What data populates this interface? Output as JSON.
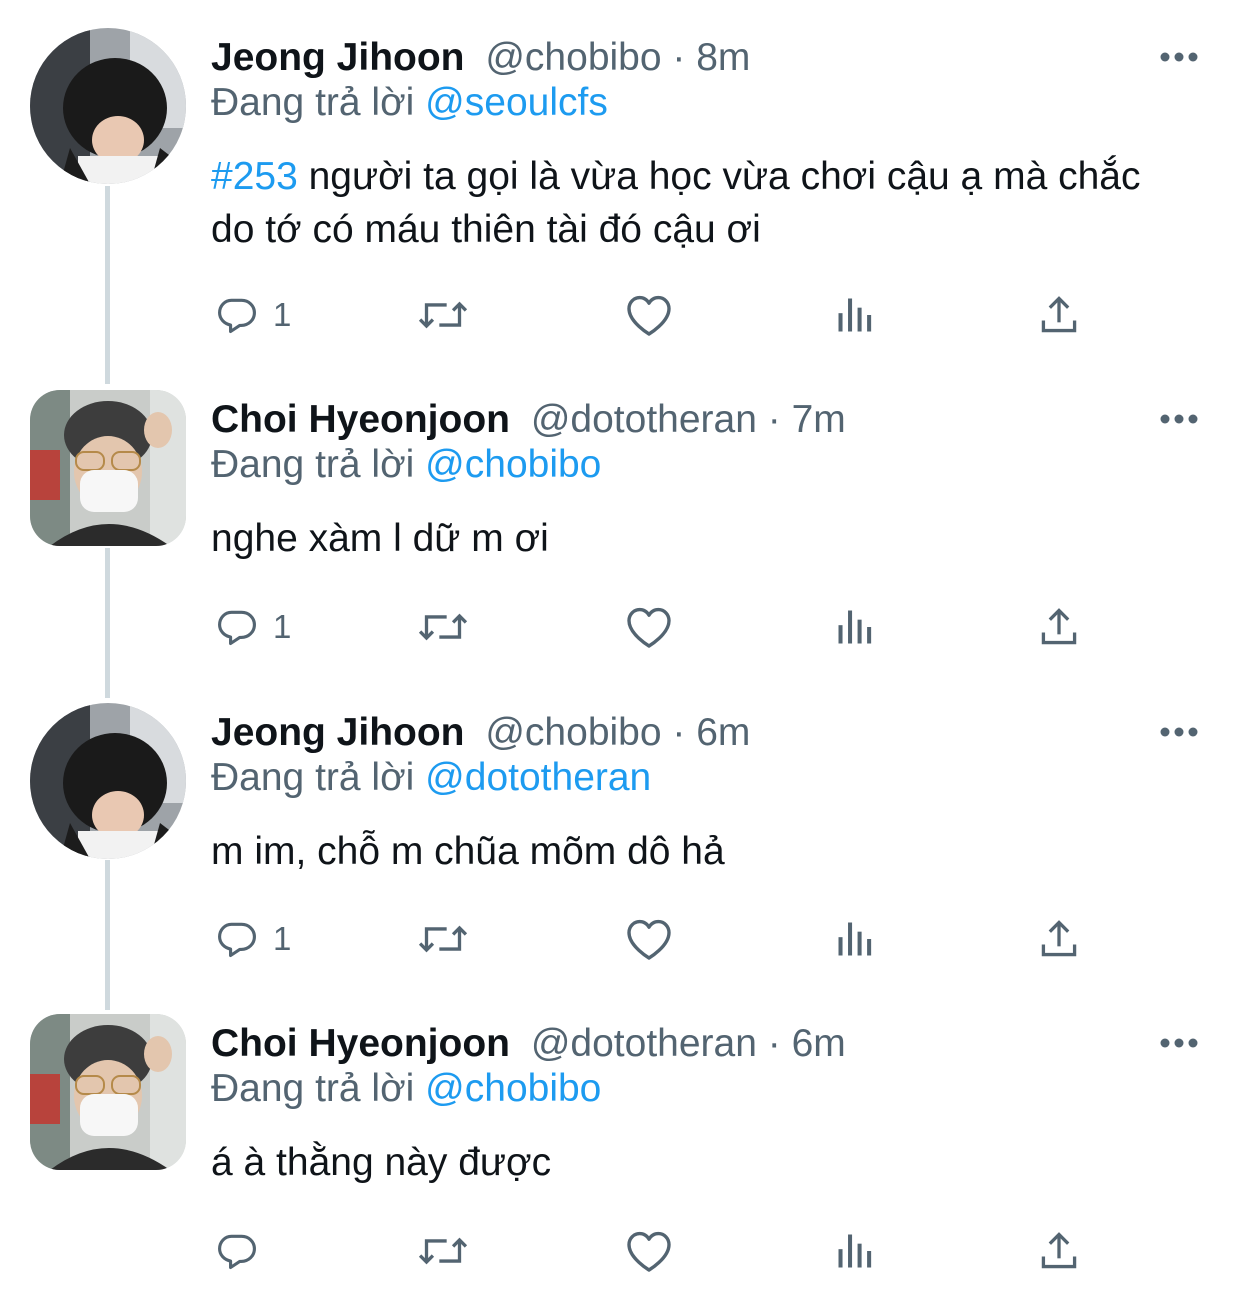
{
  "tweets": [
    {
      "name": "Jeong Jihoon",
      "handle": "@chobibo",
      "time": "8m",
      "replying_prefix": "Đang trả lời",
      "replying_to": "@seoulcfs",
      "hashtag": "#253",
      "text": " người ta gọi là vừa học vừa chơi cậu ạ mà chắc do tớ có máu thiên tài đó cậu ơi",
      "reply_count": "1"
    },
    {
      "name": "Choi Hyeonjoon",
      "handle": "@dototheran",
      "time": "7m",
      "replying_prefix": "Đang trả lời",
      "replying_to": "@chobibo",
      "hashtag": "",
      "text": "nghe xàm l dữ m ơi",
      "reply_count": "1"
    },
    {
      "name": "Jeong Jihoon",
      "handle": "@chobibo",
      "time": "6m",
      "replying_prefix": "Đang trả lời",
      "replying_to": "@dototheran",
      "hashtag": "",
      "text": "m im, chỗ m chũa mõm dô hả",
      "reply_count": "1"
    },
    {
      "name": "Choi Hyeonjoon",
      "handle": "@dototheran",
      "time": "6m",
      "replying_prefix": "Đang trả lời",
      "replying_to": "@chobibo",
      "hashtag": "",
      "text": "á à thằng này được",
      "reply_count": ""
    }
  ],
  "separator": " · ",
  "icons": {
    "reply": "reply-icon",
    "retweet": "retweet-icon",
    "like": "heart-icon",
    "analytics": "analytics-icon",
    "share": "share-icon",
    "more": "more-icon"
  },
  "colors": {
    "text": "#0f1419",
    "secondary": "#536471",
    "accent": "#1d9bf0",
    "thread_line": "#cfd9de"
  }
}
